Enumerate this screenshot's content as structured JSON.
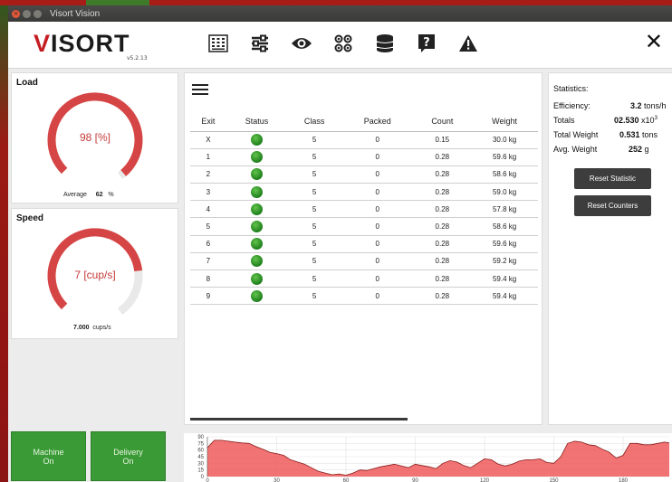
{
  "window": {
    "title": "Visort Vision"
  },
  "header": {
    "logo_main": "ISORT",
    "logo_v": "V",
    "version": "v5.2.13",
    "toolbar": [
      "keypad-icon",
      "settings-sliders-icon",
      "eye-icon",
      "components-icon",
      "database-icon",
      "help-icon",
      "warning-icon"
    ],
    "close": "✕"
  },
  "load": {
    "title": "Load",
    "value_label": "98 [%]",
    "value": 98,
    "average_label": "Average",
    "average_value": "62",
    "average_unit": "%"
  },
  "speed": {
    "title": "Speed",
    "value_label": "7 [cup/s]",
    "value": 0.78,
    "rate_value": "7.000",
    "rate_unit": "cups/s"
  },
  "table": {
    "columns": [
      "Exit",
      "Status",
      "Class",
      "Packed",
      "Count",
      "Weight"
    ],
    "rows": [
      {
        "exit": "X",
        "class": "5",
        "packed": "0",
        "count": "0.15",
        "weight": "30.0 kg"
      },
      {
        "exit": "1",
        "class": "5",
        "packed": "0",
        "count": "0.28",
        "weight": "59.6 kg"
      },
      {
        "exit": "2",
        "class": "5",
        "packed": "0",
        "count": "0.28",
        "weight": "58.6 kg"
      },
      {
        "exit": "3",
        "class": "5",
        "packed": "0",
        "count": "0.28",
        "weight": "59.0 kg"
      },
      {
        "exit": "4",
        "class": "5",
        "packed": "0",
        "count": "0.28",
        "weight": "57.8 kg"
      },
      {
        "exit": "5",
        "class": "5",
        "packed": "0",
        "count": "0.28",
        "weight": "58.6 kg"
      },
      {
        "exit": "6",
        "class": "5",
        "packed": "0",
        "count": "0.28",
        "weight": "59.6 kg"
      },
      {
        "exit": "7",
        "class": "5",
        "packed": "0",
        "count": "0.28",
        "weight": "59.2 kg"
      },
      {
        "exit": "8",
        "class": "5",
        "packed": "0",
        "count": "0.28",
        "weight": "59.4 kg"
      },
      {
        "exit": "9",
        "class": "5",
        "packed": "0",
        "count": "0.28",
        "weight": "59.4 kg"
      }
    ]
  },
  "statistics": {
    "title": "Statistics:",
    "efficiency_label": "Efficiency:",
    "efficiency_value": "3.2",
    "efficiency_unit": "tons/h",
    "totals_label": "Totals",
    "totals_value": "02.530",
    "totals_unit": "x10",
    "totals_exp": "3",
    "total_weight_label": "Total Weight",
    "total_weight_value": "0.531",
    "total_weight_unit": "tons",
    "avg_weight_label": "Avg. Weight",
    "avg_weight_value": "252",
    "avg_weight_unit": "g",
    "reset_statistic": "Reset Statistic",
    "reset_counters": "Reset Counters"
  },
  "status_buttons": {
    "machine": [
      "Machine",
      "On"
    ],
    "delivery": [
      "Delivery",
      "On"
    ]
  },
  "colors": {
    "accent": "#c41c22",
    "status_green": "#3a9a35",
    "chart_fill": "#ef5a5a"
  },
  "chart_data": {
    "type": "area",
    "y_ticks": [
      "90",
      "75",
      "60",
      "45",
      "30",
      "15",
      "0"
    ],
    "x_ticks": [
      "0",
      "30",
      "60",
      "90",
      "120",
      "150",
      "180"
    ],
    "xlim": [
      0,
      200
    ],
    "ylim": [
      0,
      90
    ],
    "x": [
      0,
      3,
      6,
      9,
      12,
      15,
      18,
      21,
      24,
      27,
      30,
      33,
      36,
      39,
      42,
      45,
      48,
      51,
      54,
      57,
      60,
      63,
      66,
      69,
      72,
      75,
      78,
      81,
      84,
      87,
      90,
      93,
      96,
      99,
      102,
      105,
      108,
      111,
      114,
      117,
      120,
      123,
      126,
      129,
      132,
      135,
      138,
      141,
      144,
      147,
      150,
      153,
      156,
      159,
      162,
      165,
      168,
      171,
      174,
      177,
      180,
      183,
      186,
      189,
      192,
      195,
      198,
      200
    ],
    "values": [
      65,
      82,
      82,
      80,
      78,
      76,
      75,
      68,
      62,
      55,
      52,
      48,
      38,
      33,
      28,
      20,
      12,
      8,
      4,
      6,
      3,
      8,
      15,
      14,
      18,
      22,
      25,
      28,
      24,
      20,
      28,
      25,
      22,
      18,
      30,
      36,
      33,
      25,
      20,
      30,
      40,
      38,
      28,
      24,
      28,
      35,
      38,
      38,
      40,
      32,
      30,
      45,
      75,
      80,
      78,
      72,
      70,
      62,
      55,
      42,
      48,
      75,
      75,
      72,
      72,
      75,
      78,
      76
    ],
    "grid": true
  }
}
